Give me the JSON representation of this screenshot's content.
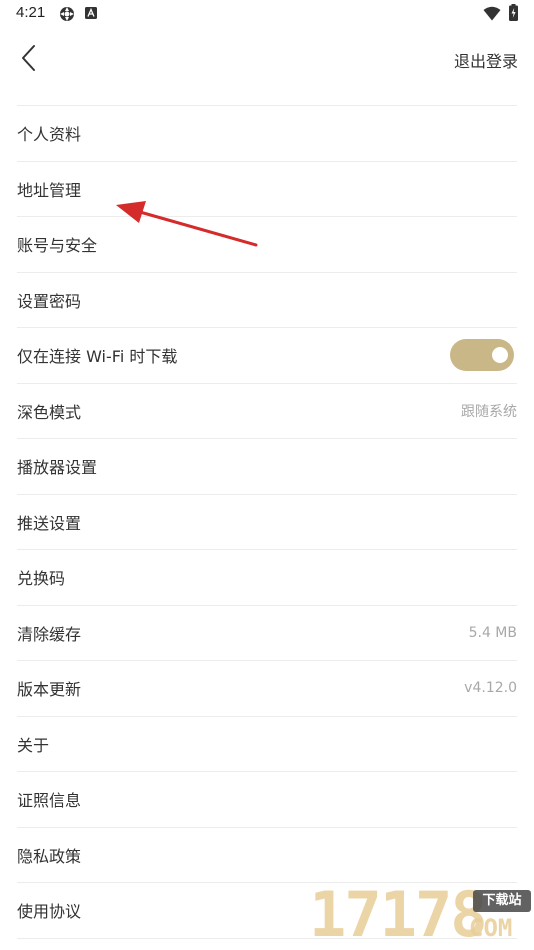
{
  "status_bar": {
    "time": "4:21",
    "icons": [
      "settings-gear-icon",
      "notification-a-icon",
      "wifi-icon",
      "battery-charging-icon"
    ]
  },
  "header": {
    "back_icon": "chevron-left-icon",
    "logout_label": "退出登录"
  },
  "settings": {
    "items": [
      {
        "label": "个人资料"
      },
      {
        "label": "地址管理"
      },
      {
        "label": "账号与安全"
      },
      {
        "label": "设置密码"
      },
      {
        "label": "仅在连接 Wi-Fi 时下载",
        "toggle_on": true
      },
      {
        "label": "深色模式",
        "value": "跟随系统"
      },
      {
        "label": "播放器设置"
      },
      {
        "label": "推送设置"
      },
      {
        "label": "兑换码"
      },
      {
        "label": "清除缓存",
        "value": "5.4 MB"
      },
      {
        "label": "版本更新",
        "value": "v4.12.0"
      },
      {
        "label": "关于"
      },
      {
        "label": "证照信息"
      },
      {
        "label": "隐私政策"
      },
      {
        "label": "使用协议"
      }
    ]
  },
  "watermark": {
    "digits": "17178",
    "badge": "下载站",
    "suffix": "COM"
  },
  "colors": {
    "toggle_on": "#c9b787",
    "divider": "#ececec",
    "text_primary": "#333333",
    "text_secondary": "#a8a8a8",
    "arrow": "#d42b2b"
  }
}
